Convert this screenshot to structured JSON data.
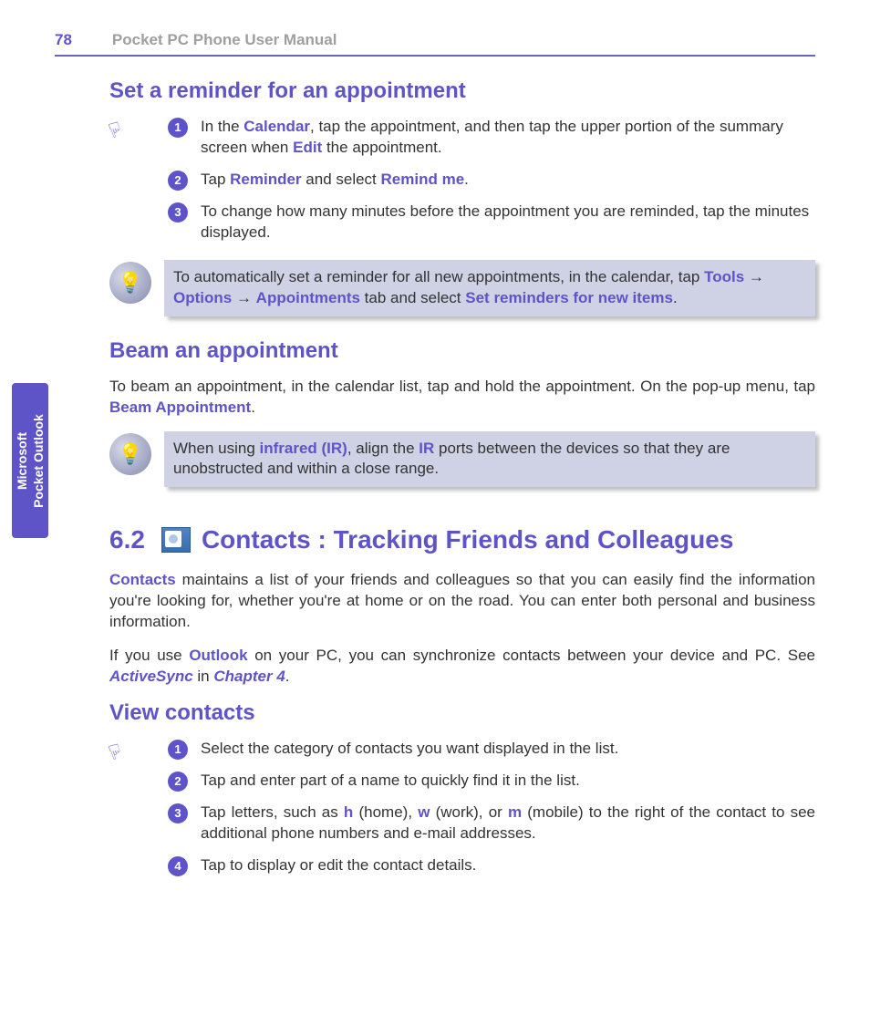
{
  "header": {
    "page_number": "78",
    "manual_title": "Pocket PC Phone User Manual"
  },
  "side_tab": {
    "line1": "Microsoft",
    "line2": "Pocket Outlook"
  },
  "section_reminder": {
    "title": "Set a reminder for an appointment",
    "steps": {
      "s1": {
        "num": "1",
        "t1": "In the ",
        "kw1": "Calendar",
        "t2": ", tap the appointment, and then tap the upper portion of the summary screen when ",
        "kw2": "Edit",
        "t3": " the appointment."
      },
      "s2": {
        "num": "2",
        "t1": "Tap ",
        "kw1": "Reminder",
        "t2": " and select ",
        "kw2": "Remind me",
        "t3": "."
      },
      "s3": {
        "num": "3",
        "t1": "To change how many minutes before the appointment you are reminded, tap the minutes displayed."
      }
    },
    "tip": {
      "t1": "To automatically set a reminder for all new appointments, in the calendar, tap ",
      "kw1": "Tools",
      "arrow1": " → ",
      "kw2": "Options",
      "arrow2": " → ",
      "kw3": "Appointments",
      "t2": " tab and select ",
      "kw4": "Set reminders for new items",
      "t3": "."
    }
  },
  "section_beam": {
    "title": "Beam an appointment",
    "para": {
      "t1": "To beam an appointment, in the calendar list, tap and hold the appointment. On the pop-up menu, tap ",
      "kw1": "Beam Appointment",
      "t2": "."
    },
    "tip": {
      "t1": "When using ",
      "kw1": "infrared (IR)",
      "t2": ", align the ",
      "kw2": "IR",
      "t3": " ports between the devices so that they are unobstructed and within a close range."
    }
  },
  "section_contacts": {
    "number": "6.2",
    "title_rest": "Contacts : Tracking Friends and Colleagues",
    "para1": {
      "kw1": "Contacts",
      "t1": " maintains a list of your friends and colleagues so that you can easily find the information you're looking for, whether you're at home or on the road. You can enter both personal and business information."
    },
    "para2": {
      "t1": "If you use ",
      "kw1": "Outlook",
      "t2": " on your PC, you can synchronize contacts between your device and PC. See ",
      "kw2": "ActiveSync",
      "t3": " in ",
      "kw3": "Chapter 4",
      "t4": "."
    }
  },
  "section_view": {
    "title": "View contacts",
    "steps": {
      "s1": {
        "num": "1",
        "t1": "Select the category of contacts you want displayed in the list."
      },
      "s2": {
        "num": "2",
        "t1": "Tap and enter part of a name to quickly find it in the list."
      },
      "s3": {
        "num": "3",
        "t1": "Tap letters, such as ",
        "kw1": "h",
        "t2": " (home), ",
        "kw2": "w",
        "t3": " (work), or ",
        "kw3": "m",
        "t4": " (mobile) to the right of the contact to see additional phone numbers and e-mail addresses."
      },
      "s4": {
        "num": "4",
        "t1": "Tap  to display or edit the contact details."
      }
    }
  }
}
